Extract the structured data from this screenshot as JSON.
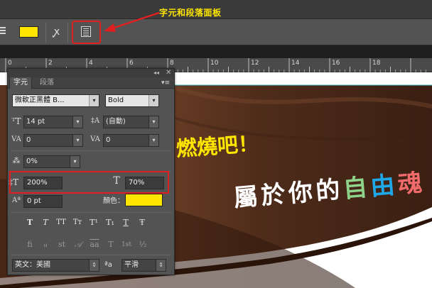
{
  "annotation": {
    "label": "字元和段落面板"
  },
  "options_bar": {
    "text_color": "#ffe600",
    "warp_icon_glyph": "ꭙ"
  },
  "ruler": {
    "ticks": [
      "0",
      "2",
      "4",
      "6",
      "8",
      "10",
      "12",
      "14",
      "16",
      "18"
    ]
  },
  "canvas": {
    "line1": "燃燒吧！",
    "line2_chars": [
      {
        "ch": "屬",
        "color": "#ffffff"
      },
      {
        "ch": "於",
        "color": "#ffffff"
      },
      {
        "ch": "你",
        "color": "#ffffff"
      },
      {
        "ch": "的",
        "color": "#ffffff"
      },
      {
        "ch": "自",
        "color": "#8dd38a"
      },
      {
        "ch": "由",
        "color": "#1ea8e8"
      },
      {
        "ch": "魂",
        "color": "#f06b6b"
      }
    ],
    "line1_color": "#ffe600"
  },
  "panel": {
    "tabs": {
      "character": "字元",
      "paragraph": "段落"
    },
    "font_family": "微軟正黑體 B...",
    "font_style": "Bold",
    "font_size": "14 pt",
    "leading": "(自動)",
    "kerning": "0",
    "tracking": "0",
    "tsume": "0%",
    "vertical_scale": "200%",
    "horizontal_scale": "70%",
    "baseline_shift": "0 pt",
    "color_label": "顏色：",
    "color_value": "#ffe600",
    "type_styles": [
      "T",
      "T",
      "TT",
      "Tт",
      "T¹",
      "T₁",
      "T",
      "Ŧ"
    ],
    "opentype_styles": [
      "fi",
      "ℴ",
      "st",
      "𝒜",
      "aa",
      "T",
      "1st",
      "½"
    ],
    "language": "英文：美國",
    "aa_label": "ªa",
    "antialias": "平滑"
  }
}
